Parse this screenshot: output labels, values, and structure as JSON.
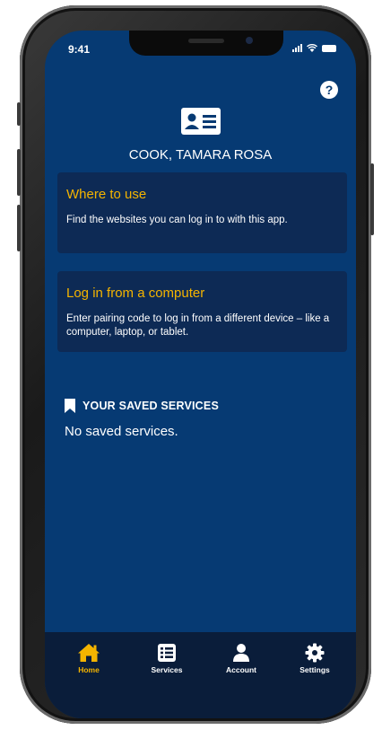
{
  "status_bar": {
    "time": "9:41"
  },
  "header": {
    "user_name": "COOK, TAMARA ROSA",
    "help_glyph": "?"
  },
  "cards": [
    {
      "title": "Where to use",
      "description": "Find the websites you can log in to with this app."
    },
    {
      "title": "Log in from a computer",
      "description": "Enter pairing code to log in from a different device – like a computer, laptop, or tablet."
    }
  ],
  "saved_services": {
    "header": "YOUR SAVED SERVICES",
    "empty_text": "No saved services."
  },
  "tabs": [
    {
      "label": "Home",
      "icon": "home-icon",
      "active": true
    },
    {
      "label": "Services",
      "icon": "list-icon",
      "active": false
    },
    {
      "label": "Account",
      "icon": "person-icon",
      "active": false
    },
    {
      "label": "Settings",
      "icon": "gear-icon",
      "active": false
    }
  ],
  "colors": {
    "background": "#063a73",
    "card": "#0d2a55",
    "accent": "#f4b400",
    "tabbar": "#0a1d3a"
  }
}
